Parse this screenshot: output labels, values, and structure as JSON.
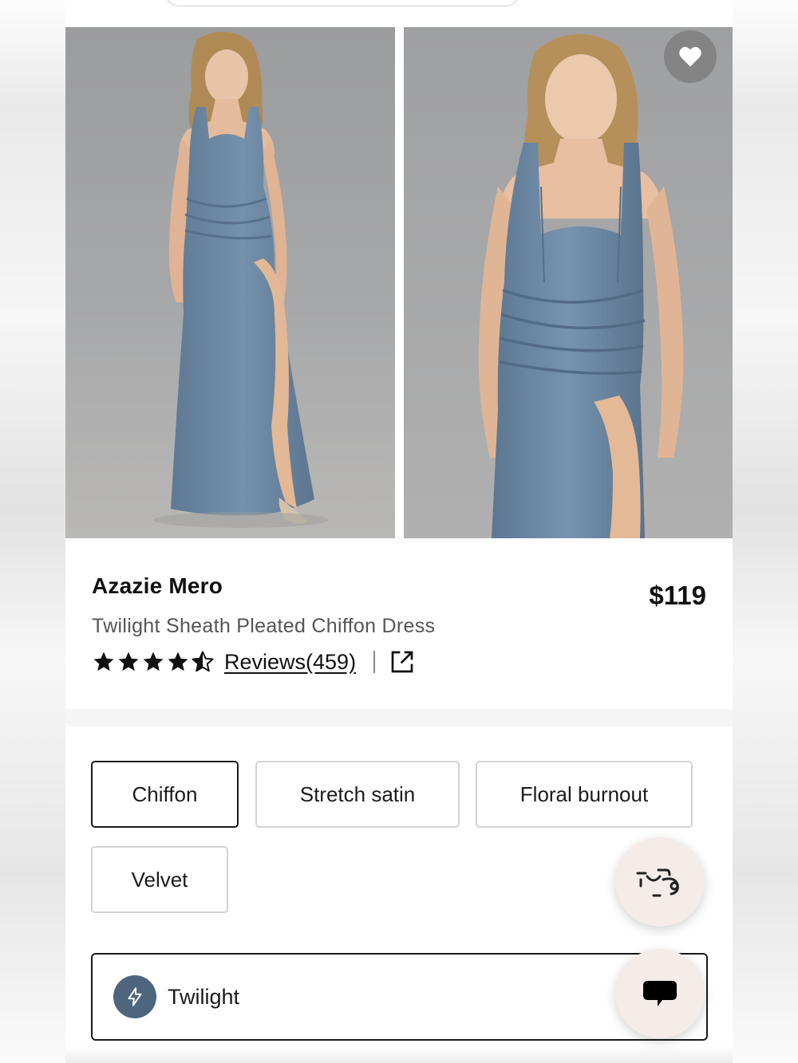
{
  "product": {
    "brand": "Azazie Mero",
    "name": "Twilight Sheath Pleated Chiffon Dress",
    "price": "$119",
    "rating": 4.5,
    "rating_max": 5,
    "reviews_label": "Reviews(459)"
  },
  "fabrics": {
    "selected": "Chiffon",
    "options": [
      "Chiffon",
      "Stretch satin",
      "Floral burnout",
      "Velvet"
    ]
  },
  "color": {
    "selected_label": "Twilight",
    "swatch_hex": "#4e6580"
  },
  "icons": {
    "favorite": "heart-icon",
    "share": "external-link-icon",
    "color_swatch": "lightning-icon",
    "fab_cart": "bag-icon",
    "fab_chat": "chat-bubble-icon"
  },
  "colors": {
    "dress": "#6f8aa5",
    "studio_bg": "#a9aaac",
    "text_primary": "#111111",
    "text_secondary": "#555555",
    "fab_bg": "#f3ece8"
  }
}
